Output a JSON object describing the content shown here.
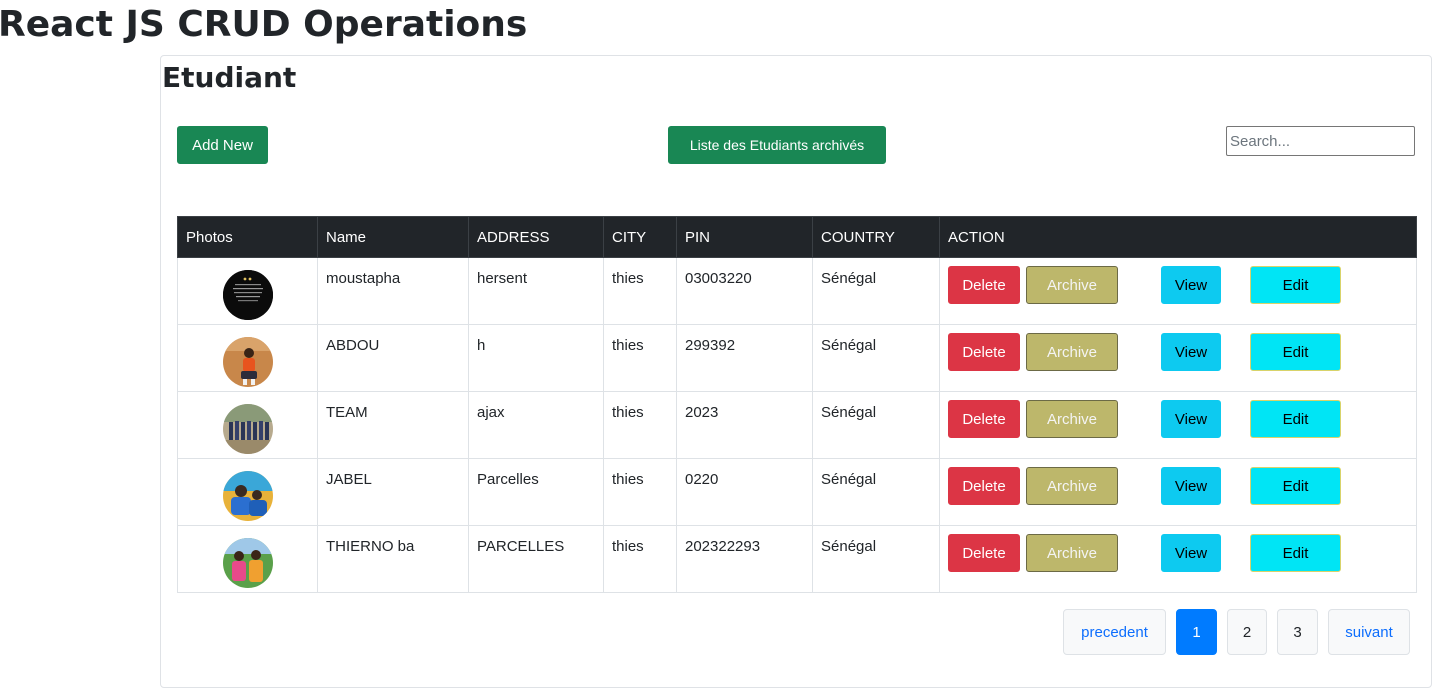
{
  "app": {
    "title": "React JS CRUD Operations"
  },
  "card": {
    "title": "Etudiant"
  },
  "toolbar": {
    "add_label": "Add New",
    "archived_label": "Liste des Etudiants archivés",
    "search_placeholder": "Search..."
  },
  "table": {
    "headers": [
      "Photos",
      "Name",
      "ADDRESS",
      "CITY",
      "PIN",
      "COUNTRY",
      "ACTION"
    ],
    "rows": [
      {
        "name": "moustapha",
        "address": "hersent",
        "city": "thies",
        "pin": "03003220",
        "country": "Sénégal"
      },
      {
        "name": "ABDOU",
        "address": "h",
        "city": "thies",
        "pin": "299392",
        "country": "Sénégal"
      },
      {
        "name": "TEAM",
        "address": "ajax",
        "city": "thies",
        "pin": "2023",
        "country": "Sénégal"
      },
      {
        "name": "JABEL",
        "address": "Parcelles",
        "city": "thies",
        "pin": "0220",
        "country": "Sénégal"
      },
      {
        "name": "THIERNO ba",
        "address": "PARCELLES",
        "city": "thies",
        "pin": "202322293",
        "country": "Sénégal"
      }
    ],
    "actions": {
      "delete": "Delete",
      "archive": "Archive",
      "view": "View",
      "edit": "Edit"
    }
  },
  "pagination": {
    "prev": "precedent",
    "pages": [
      "1",
      "2",
      "3"
    ],
    "next": "suivant",
    "active": "1"
  },
  "colors": {
    "success": "#198754",
    "danger": "#dc3545",
    "archive": "#bdb76b",
    "info": "#0dcaf0",
    "edit": "#00e5f5",
    "header_dark": "#212529",
    "page_active": "#007bff"
  }
}
